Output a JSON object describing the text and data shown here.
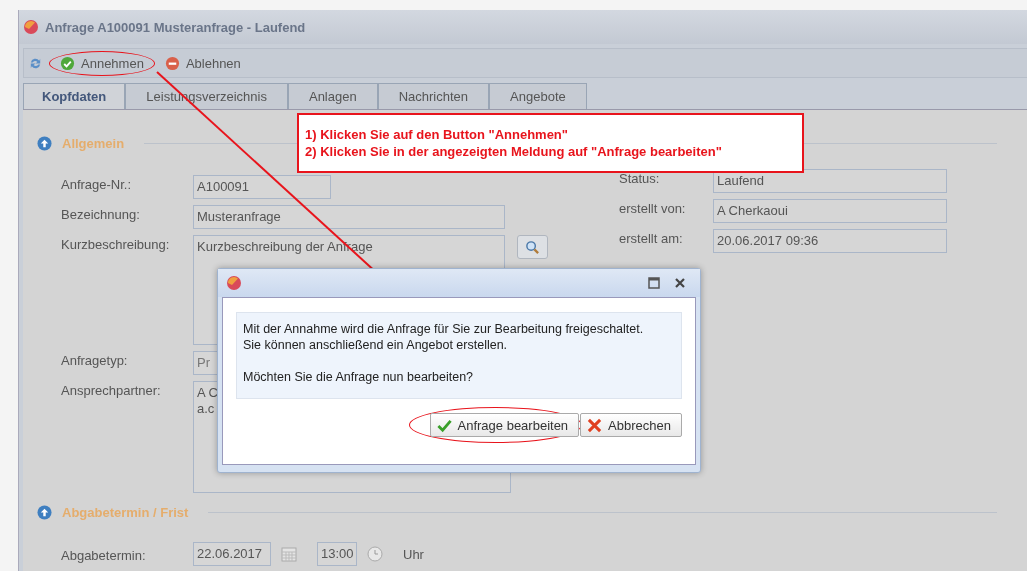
{
  "window": {
    "title": "Anfrage A100091 Musteranfrage - Laufend"
  },
  "toolbar": [
    {
      "kind": "accept",
      "label": "Annehmen",
      "circled": true
    },
    {
      "kind": "reject",
      "label": "Ablehnen",
      "circled": false
    }
  ],
  "tabs": [
    {
      "label": "Kopfdaten",
      "selected": true
    },
    {
      "label": "Leistungsverzeichnis",
      "selected": false
    },
    {
      "label": "Anlagen",
      "selected": false
    },
    {
      "label": "Nachrichten",
      "selected": false
    },
    {
      "label": "Angebote",
      "selected": false
    }
  ],
  "annotation": {
    "lines": [
      "1) Klicken Sie auf den Button \"Annehmen\"",
      "2) Klicken Sie in der angezeigten Meldung auf \"Anfrage bearbeiten\""
    ]
  },
  "sections": [
    {
      "title": "Allgemein",
      "left_fields": [
        {
          "kind": "short",
          "label": "Anfrage-Nr.:",
          "value": "A100091"
        },
        {
          "kind": "wide",
          "label": "Bezeichnung:",
          "value": "Musteranfrage"
        },
        {
          "kind": "textarea",
          "label": "Kurzbeschreibung:",
          "value": "Kurzbeschreibung der Anfrage",
          "search": true
        },
        {
          "kind": "select",
          "label": "Anfragetyp:",
          "value": "Pr"
        },
        {
          "kind": "lines",
          "label": "Ansprechpartner:",
          "lines": [
            "A C",
            "a.c"
          ]
        }
      ],
      "right_fields": [
        {
          "label": "Status:",
          "value": "Laufend"
        },
        {
          "label": "erstellt von:",
          "value": "A Cherkaoui"
        },
        {
          "label": "erstellt am:",
          "value": "20.06.2017 09:36"
        }
      ]
    },
    {
      "title": "Abgabetermin / Frist",
      "deadline": {
        "label": "Abgabetermin:",
        "date": "22.06.2017",
        "time": "13:00",
        "unit": "Uhr"
      }
    }
  ],
  "dialog": {
    "message": [
      "Mit der Annahme wird die Anfrage für Sie zur Bearbeitung freigeschaltet.",
      "Sie können anschließend ein Angebot erstellen."
    ],
    "question": "Möchten Sie die Anfrage nun bearbeiten?",
    "buttons": [
      {
        "kind": "confirm",
        "label": "Anfrage bearbeiten",
        "circled": true
      },
      {
        "kind": "cancel",
        "label": "Abbrechen",
        "circled": false
      }
    ]
  }
}
